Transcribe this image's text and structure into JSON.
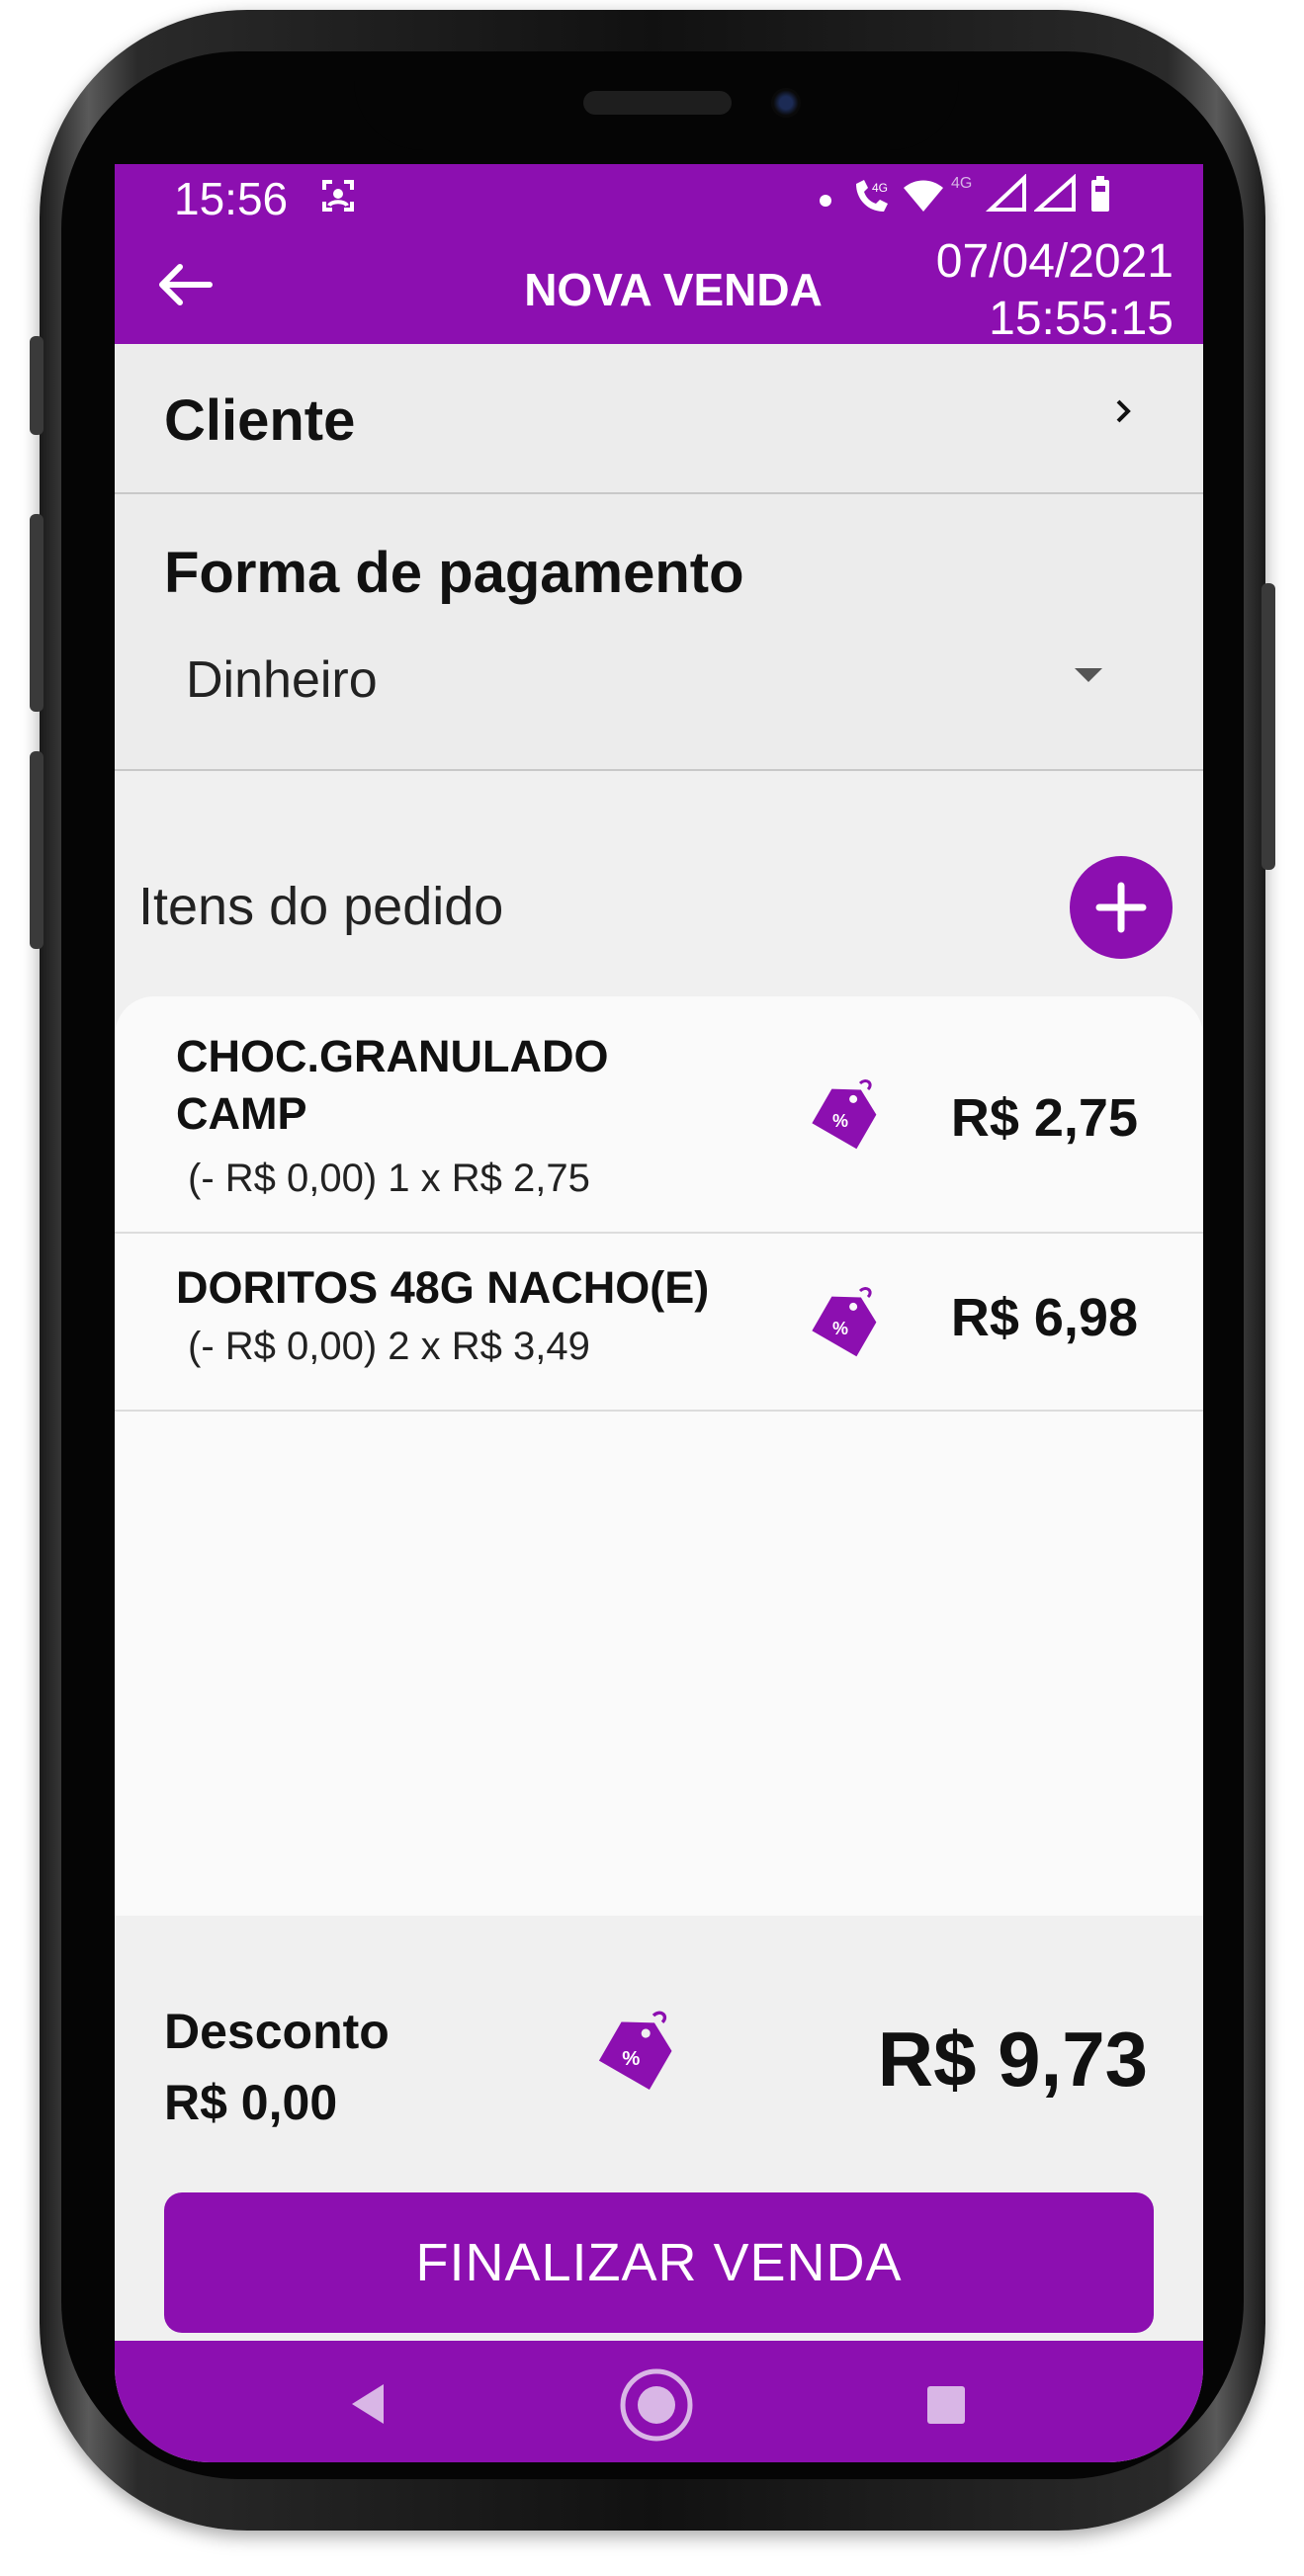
{
  "status_bar": {
    "time": "15:56"
  },
  "header": {
    "title": "NOVA VENDA",
    "date": "07/04/2021",
    "time": "15:55:15"
  },
  "cliente": {
    "label": "Cliente"
  },
  "pagamento": {
    "label": "Forma de pagamento",
    "selected": "Dinheiro"
  },
  "itens": {
    "label": "Itens do pedido",
    "list": [
      {
        "name_line1": "CHOC.GRANULADO",
        "name_line2": "CAMP",
        "detail": "(- R$ 0,00) 1 x R$ 2,75",
        "price": "R$ 2,75"
      },
      {
        "name_line1": "DORITOS 48G NACHO(E)",
        "detail": "(- R$ 0,00) 2 x R$ 3,49",
        "price": "R$ 6,98"
      }
    ]
  },
  "footer": {
    "desconto_label": "Desconto",
    "desconto_value": "R$ 0,00",
    "total": "R$ 9,73",
    "finalizar_label": "FINALIZAR VENDA"
  },
  "colors": {
    "primary": "#8c0fb0",
    "background": "#f0f0f0"
  },
  "icons": [
    "back-arrow-icon",
    "chevron-right-icon",
    "dropdown-caret-icon",
    "plus-icon",
    "discount-tag-icon",
    "nav-back-icon",
    "nav-home-icon",
    "nav-recent-icon"
  ]
}
